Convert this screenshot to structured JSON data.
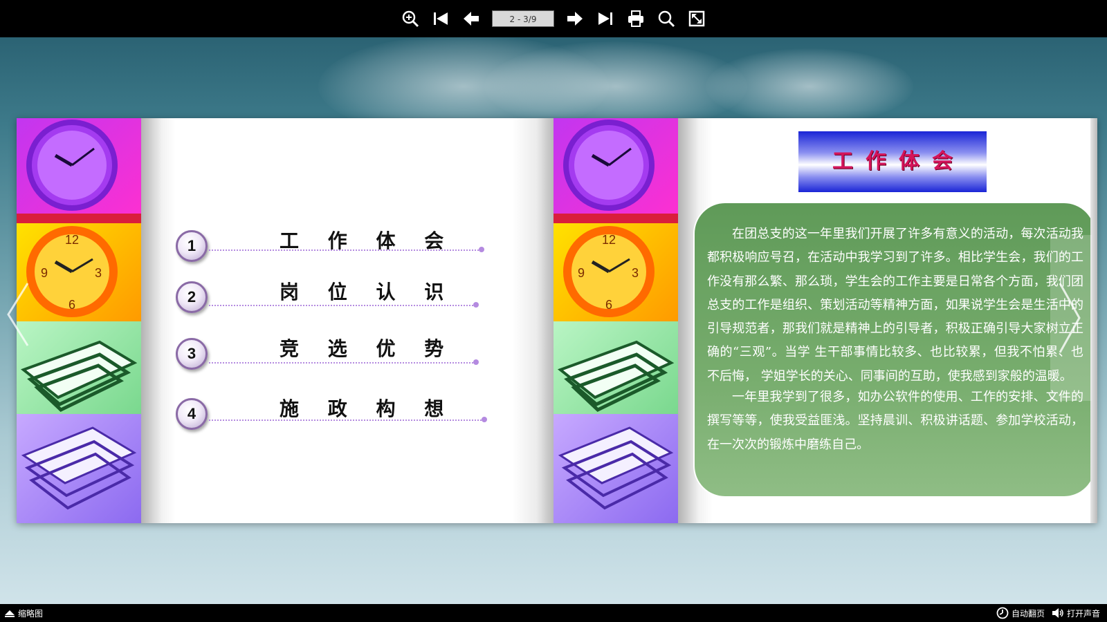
{
  "toolbar": {
    "page_indicator": "2 - 3/9",
    "icons": [
      "zoom-in-icon",
      "first-page-icon",
      "prev-page-icon",
      "next-page-icon",
      "last-page-icon",
      "print-icon",
      "search-icon",
      "fullscreen-icon"
    ]
  },
  "left_page": {
    "toc": [
      {
        "num": "1",
        "label": "工 作 体 会"
      },
      {
        "num": "2",
        "label": "岗 位 认 识"
      },
      {
        "num": "3",
        "label": "竞 选 优 势"
      },
      {
        "num": "4",
        "label": "施 政 构 想"
      }
    ]
  },
  "right_page": {
    "title": "工作体会",
    "paragraphs": [
      "在团总支的这一年里我们开展了许多有意义的活动，每次活动我都积极响应号召，在活动中我学习到了许多。相比学生会，我们的工作没有那么繁、那么琐，学生会的工作主要是日常各个方面，我们团总支的工作是组织、策划活动等精神方面，如果说学生会是生活中的引导规范者，那我们就是精神上的引导者，积极正确引导大家树立正确的“三观”。当学 生干部事情比较多、也比较累，但我不怕累、也不后悔， 学姐学长的关心、同事间的互助，使我感到家般的温暖。",
      "一年里我学到了很多，如办公软件的使用、工作的安排、文件的撰写等等，使我受益匪浅。坚持晨训、积极讲话题、参加学校活动，在一次次的锻炼中磨练自己。"
    ]
  },
  "bottombar": {
    "thumbnail_label": "缩略图",
    "auto_flip_label": "自动翻页",
    "sound_label": "打开声音"
  },
  "colors": {
    "toc_line": "#b48ae0",
    "title_text": "#d4145a",
    "panel_green": "#78ad6e"
  }
}
